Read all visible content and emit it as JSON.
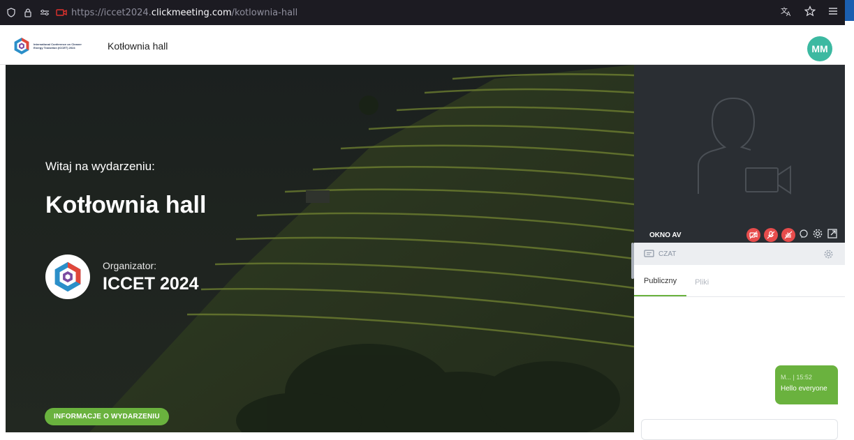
{
  "browser": {
    "url_prefix": "https://iccet2024.",
    "url_domain": "clickmeeting.com",
    "url_path": "/kotlownia-hall"
  },
  "header": {
    "logo_text": "International Conference on Cleaner Energy Transition (ICCET) 2024",
    "room_title": "Kotłownia hall",
    "avatar_initials": "MM"
  },
  "hero": {
    "welcome": "Witaj na wydarzeniu:",
    "event_name": "Kotłownia hall",
    "organizer_label": "Organizator:",
    "organizer_name": "ICCET 2024",
    "info_button": "INFORMACJE O WYDARZENIU"
  },
  "av": {
    "label": "OKNO AV"
  },
  "chat": {
    "title": "CZAT",
    "tabs": [
      "Publiczny",
      "Pliki"
    ],
    "message": {
      "meta": "M... | 15:52",
      "text": "Hello everyone"
    }
  },
  "colors": {
    "accent_green": "#6ab23e",
    "avatar_teal": "#3cb9a1",
    "control_red": "#e74c4c",
    "browser_bg": "#1c1b22"
  }
}
